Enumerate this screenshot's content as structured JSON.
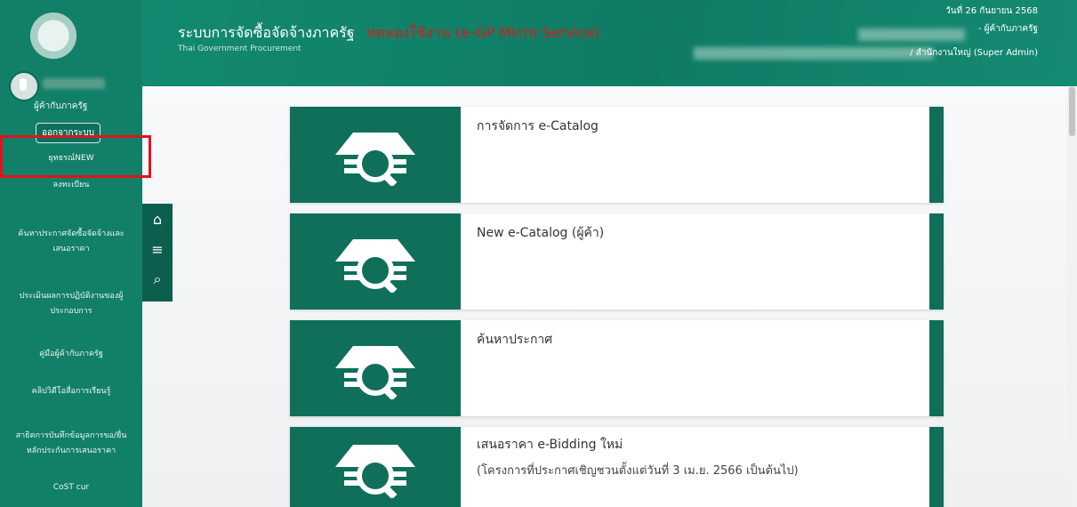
{
  "banner": {
    "title": "ระบบการจัดซื้อจัดจ้างภาครัฐ",
    "mode": "ทดลองใช้งาน (e-GP Micro Service)",
    "subtitle": "Thai Government Procurement",
    "date": "วันที่ 26 กันยายน 2568",
    "user_title": "- ผู้ค้ากับภาครัฐ",
    "org_line": "/ สำนักงานใหญ่ (Super Admin)"
  },
  "sidebar": {
    "role": "ผู้ค้ากับภาครัฐ",
    "logout": "ออกจากระบบ",
    "items": [
      {
        "label": "ยุทธรณ์NEW"
      },
      {
        "label": "ลงทะเบียน"
      },
      {
        "label": "ค้นหาประกาศจัดซื้อจัดจ้างและเสนอราคา"
      },
      {
        "label": "ประเมินผลการปฏิบัติงานของผู้ประกอบการ"
      },
      {
        "label": "คู่มือผู้ค้ากับภาครัฐ"
      },
      {
        "label": "คลิปวิดีโอสื่อการเรียนรู้"
      },
      {
        "label": "สาธิตการบันทึกข้อมูลการขอ/ยื่นหลักประกันการเสนอราคา"
      },
      {
        "label": "CoST cur"
      }
    ]
  },
  "cards": [
    {
      "title": "การจัดการ e-Catalog",
      "subtitle": ""
    },
    {
      "title": "New e-Catalog (ผู้ค้า)",
      "subtitle": ""
    },
    {
      "title": "ค้นหาประกาศ",
      "subtitle": ""
    },
    {
      "title": "เสนอราคา e-Bidding ใหม่",
      "subtitle": "(โครงการที่ประกาศเชิญชวนตั้งแต่วันที่ 3 เม.ย. 2566 เป็นต้นไป)"
    }
  ],
  "toolbar": {
    "home_icon": "home-icon",
    "menu_icon": "hamburger-menu-icon",
    "search_icon": "search-icon"
  },
  "colors": {
    "primary": "#128068",
    "dark": "#0f6f5b",
    "highlight": "#e1121b"
  }
}
